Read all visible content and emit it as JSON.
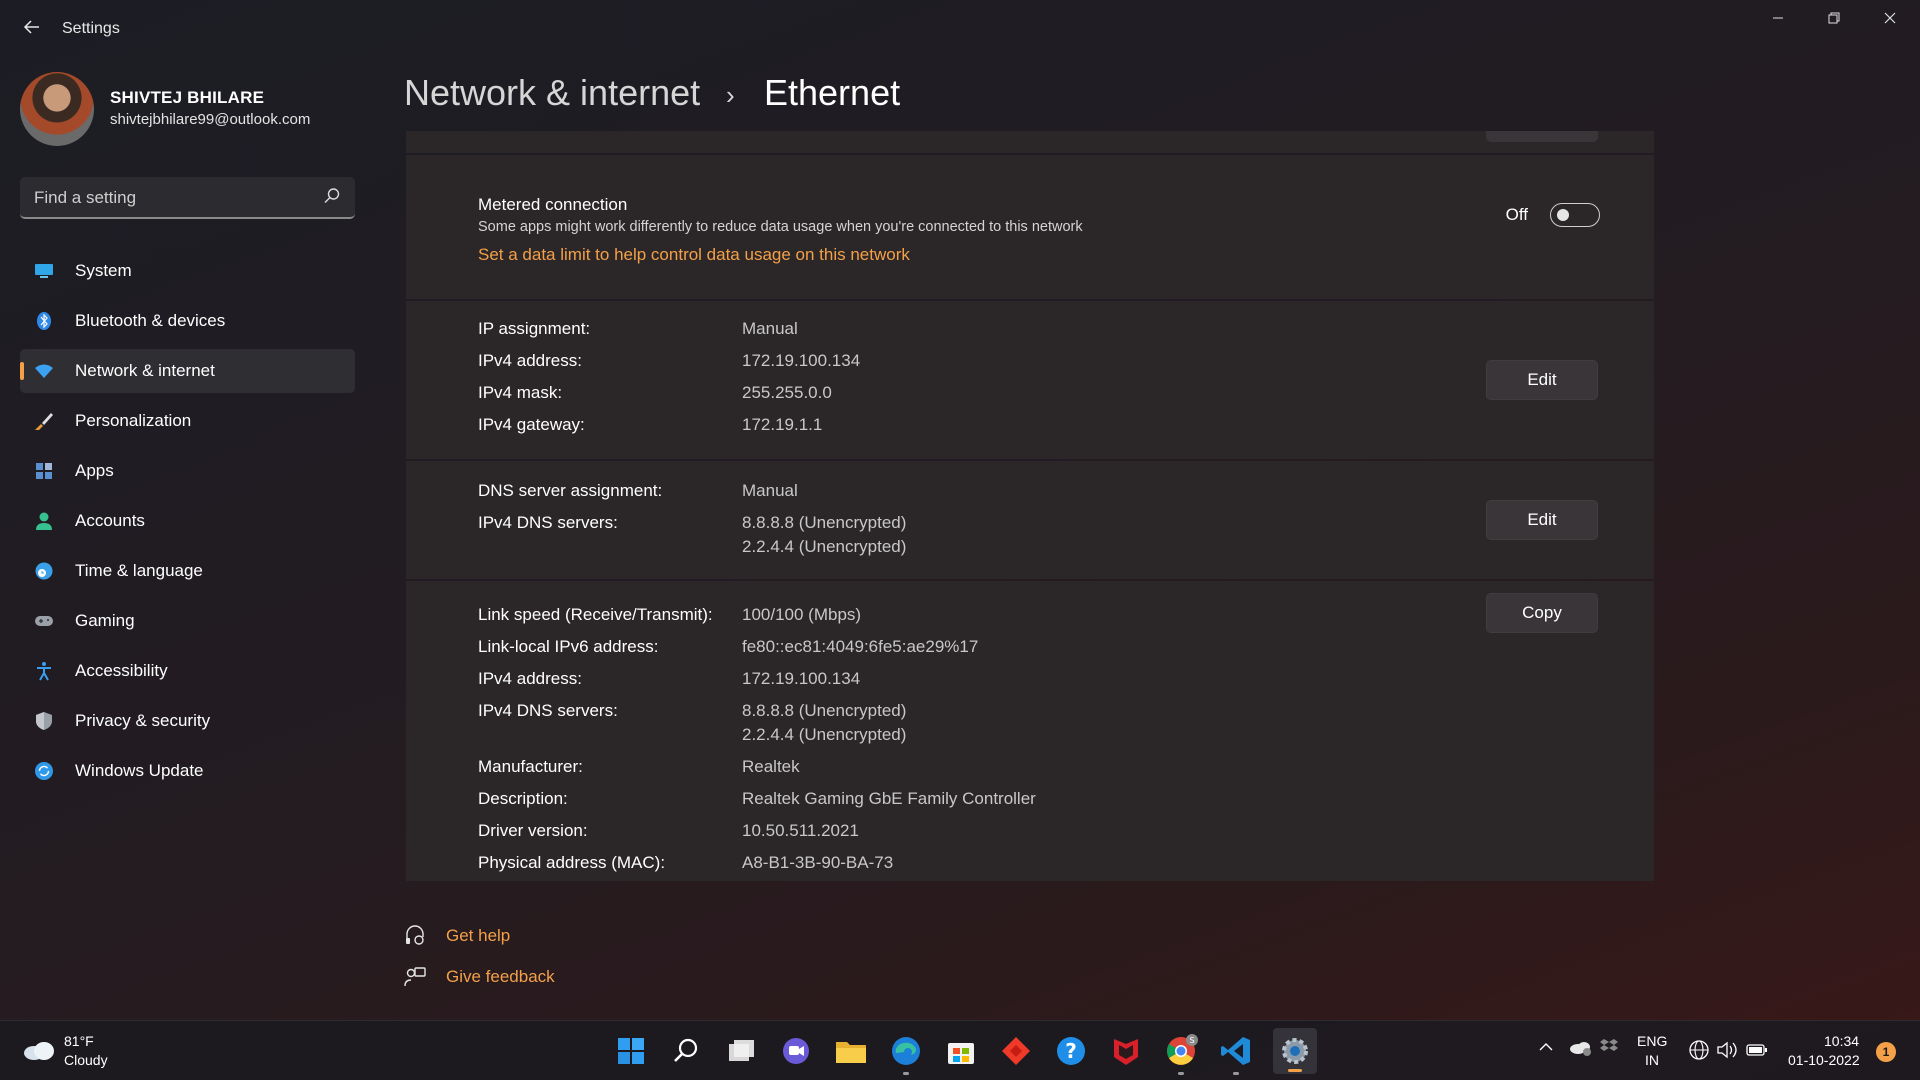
{
  "window": {
    "title": "Settings",
    "back_icon": "back-arrow-icon",
    "minimize_icon": "minimize-icon",
    "maximize_icon": "restore-icon",
    "close_icon": "close-icon"
  },
  "profile": {
    "name": "SHIVTEJ BHILARE",
    "email": "shivtejbhilare99@outlook.com"
  },
  "search": {
    "placeholder": "Find a setting",
    "icon": "search-icon"
  },
  "sidebar": {
    "items": [
      {
        "label": "System",
        "icon": "monitor-icon",
        "color": "#2fa6e8"
      },
      {
        "label": "Bluetooth & devices",
        "icon": "bluetooth-icon",
        "color": "#2f88e8"
      },
      {
        "label": "Network & internet",
        "icon": "wifi-icon",
        "color": "#3ba1f0",
        "active": true
      },
      {
        "label": "Personalization",
        "icon": "brush-icon",
        "color": "#e89a3a"
      },
      {
        "label": "Apps",
        "icon": "apps-icon",
        "color": "#5a8fd0"
      },
      {
        "label": "Accounts",
        "icon": "person-icon",
        "color": "#36c28f"
      },
      {
        "label": "Time & language",
        "icon": "globe-clock-icon",
        "color": "#3aa0e8"
      },
      {
        "label": "Gaming",
        "icon": "gamepad-icon",
        "color": "#9aa0a8"
      },
      {
        "label": "Accessibility",
        "icon": "accessibility-icon",
        "color": "#3a9ef0"
      },
      {
        "label": "Privacy & security",
        "icon": "shield-icon",
        "color": "#9aa0a8"
      },
      {
        "label": "Windows Update",
        "icon": "update-icon",
        "color": "#2f98e8"
      }
    ]
  },
  "breadcrumb": {
    "parent": "Network & internet",
    "separator": "›",
    "current": "Ethernet"
  },
  "metered": {
    "title": "Metered connection",
    "description": "Some apps might work differently to reduce data usage when you're connected to this network",
    "toggle_label": "Off",
    "toggle_on": false,
    "link": "Set a data limit to help control data usage on this network"
  },
  "ip_settings": {
    "rows": [
      {
        "key": "IP assignment:",
        "value": "Manual"
      },
      {
        "key": "IPv4 address:",
        "value": "172.19.100.134"
      },
      {
        "key": "IPv4 mask:",
        "value": "255.255.0.0"
      },
      {
        "key": "IPv4 gateway:",
        "value": "172.19.1.1"
      }
    ],
    "button": "Edit"
  },
  "dns_settings": {
    "rows": [
      {
        "key": "DNS server assignment:",
        "value": "Manual"
      },
      {
        "key": "IPv4 DNS servers:",
        "value": "8.8.8.8 (Unencrypted)",
        "value2": "2.2.4.4 (Unencrypted)"
      }
    ],
    "button": "Edit"
  },
  "properties": {
    "rows": [
      {
        "key": "Link speed (Receive/Transmit):",
        "value": "100/100 (Mbps)"
      },
      {
        "key": "Link-local IPv6 address:",
        "value": "fe80::ec81:4049:6fe5:ae29%17"
      },
      {
        "key": "IPv4 address:",
        "value": "172.19.100.134"
      },
      {
        "key": "IPv4 DNS servers:",
        "value": "8.8.8.8 (Unencrypted)",
        "value2": "2.2.4.4 (Unencrypted)"
      },
      {
        "key": "Manufacturer:",
        "value": "Realtek"
      },
      {
        "key": "Description:",
        "value": "Realtek Gaming GbE Family Controller"
      },
      {
        "key": "Driver version:",
        "value": "10.50.511.2021"
      },
      {
        "key": "Physical address (MAC):",
        "value": "A8-B1-3B-90-BA-73"
      }
    ],
    "button": "Copy"
  },
  "help": {
    "get_help": "Get help",
    "give_feedback": "Give feedback"
  },
  "taskbar": {
    "weather_temp": "81°F",
    "weather_condition": "Cloudy",
    "apps": [
      {
        "name": "start-icon"
      },
      {
        "name": "search-icon"
      },
      {
        "name": "task-view-icon"
      },
      {
        "name": "chat-icon"
      },
      {
        "name": "file-explorer-icon"
      },
      {
        "name": "edge-icon",
        "running": true
      },
      {
        "name": "store-icon"
      },
      {
        "name": "anydesk-icon"
      },
      {
        "name": "help-icon"
      },
      {
        "name": "mcafee-icon"
      },
      {
        "name": "chrome-icon",
        "running": true,
        "badge": "S"
      },
      {
        "name": "vscode-icon",
        "running": true
      },
      {
        "name": "settings-gear-icon",
        "running": true,
        "active": true
      }
    ],
    "tray_chevron": "^",
    "lang_line1": "ENG",
    "lang_line2": "IN",
    "time": "10:34",
    "date": "01-10-2022",
    "notification_count": "1"
  },
  "colors": {
    "accent": "#f3a048",
    "card": "#2b2628",
    "button": "#3a3538"
  }
}
